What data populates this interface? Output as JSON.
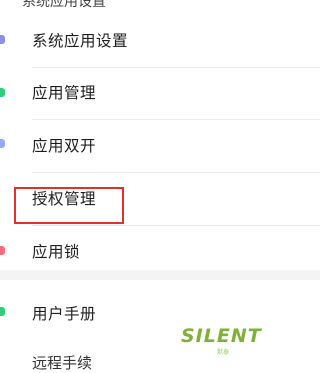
{
  "header": {
    "partial_title": "系统应用设置"
  },
  "menu": {
    "items": [
      {
        "label": "系统应用设置",
        "icon": "settings-icon",
        "color": "#8a8fe8"
      },
      {
        "label": "应用管理",
        "icon": "app-manage-icon",
        "color": "#2ecf7a"
      },
      {
        "label": "应用双开",
        "icon": "dual-app-icon",
        "color": "#9aa8ff"
      },
      {
        "label": "授权管理",
        "icon": "authorization-icon",
        "color": "#ffffff"
      },
      {
        "label": "应用锁",
        "icon": "app-lock-icon",
        "color": "#ff6b7a"
      },
      {
        "label": "用户手册",
        "icon": "user-manual-icon",
        "color": "#2ecf7a"
      }
    ]
  },
  "bottom_partial": "远程手续",
  "highlight": {
    "color": "#e0322b"
  },
  "watermark": {
    "title": "SILENT",
    "subtitle": "默泰"
  }
}
